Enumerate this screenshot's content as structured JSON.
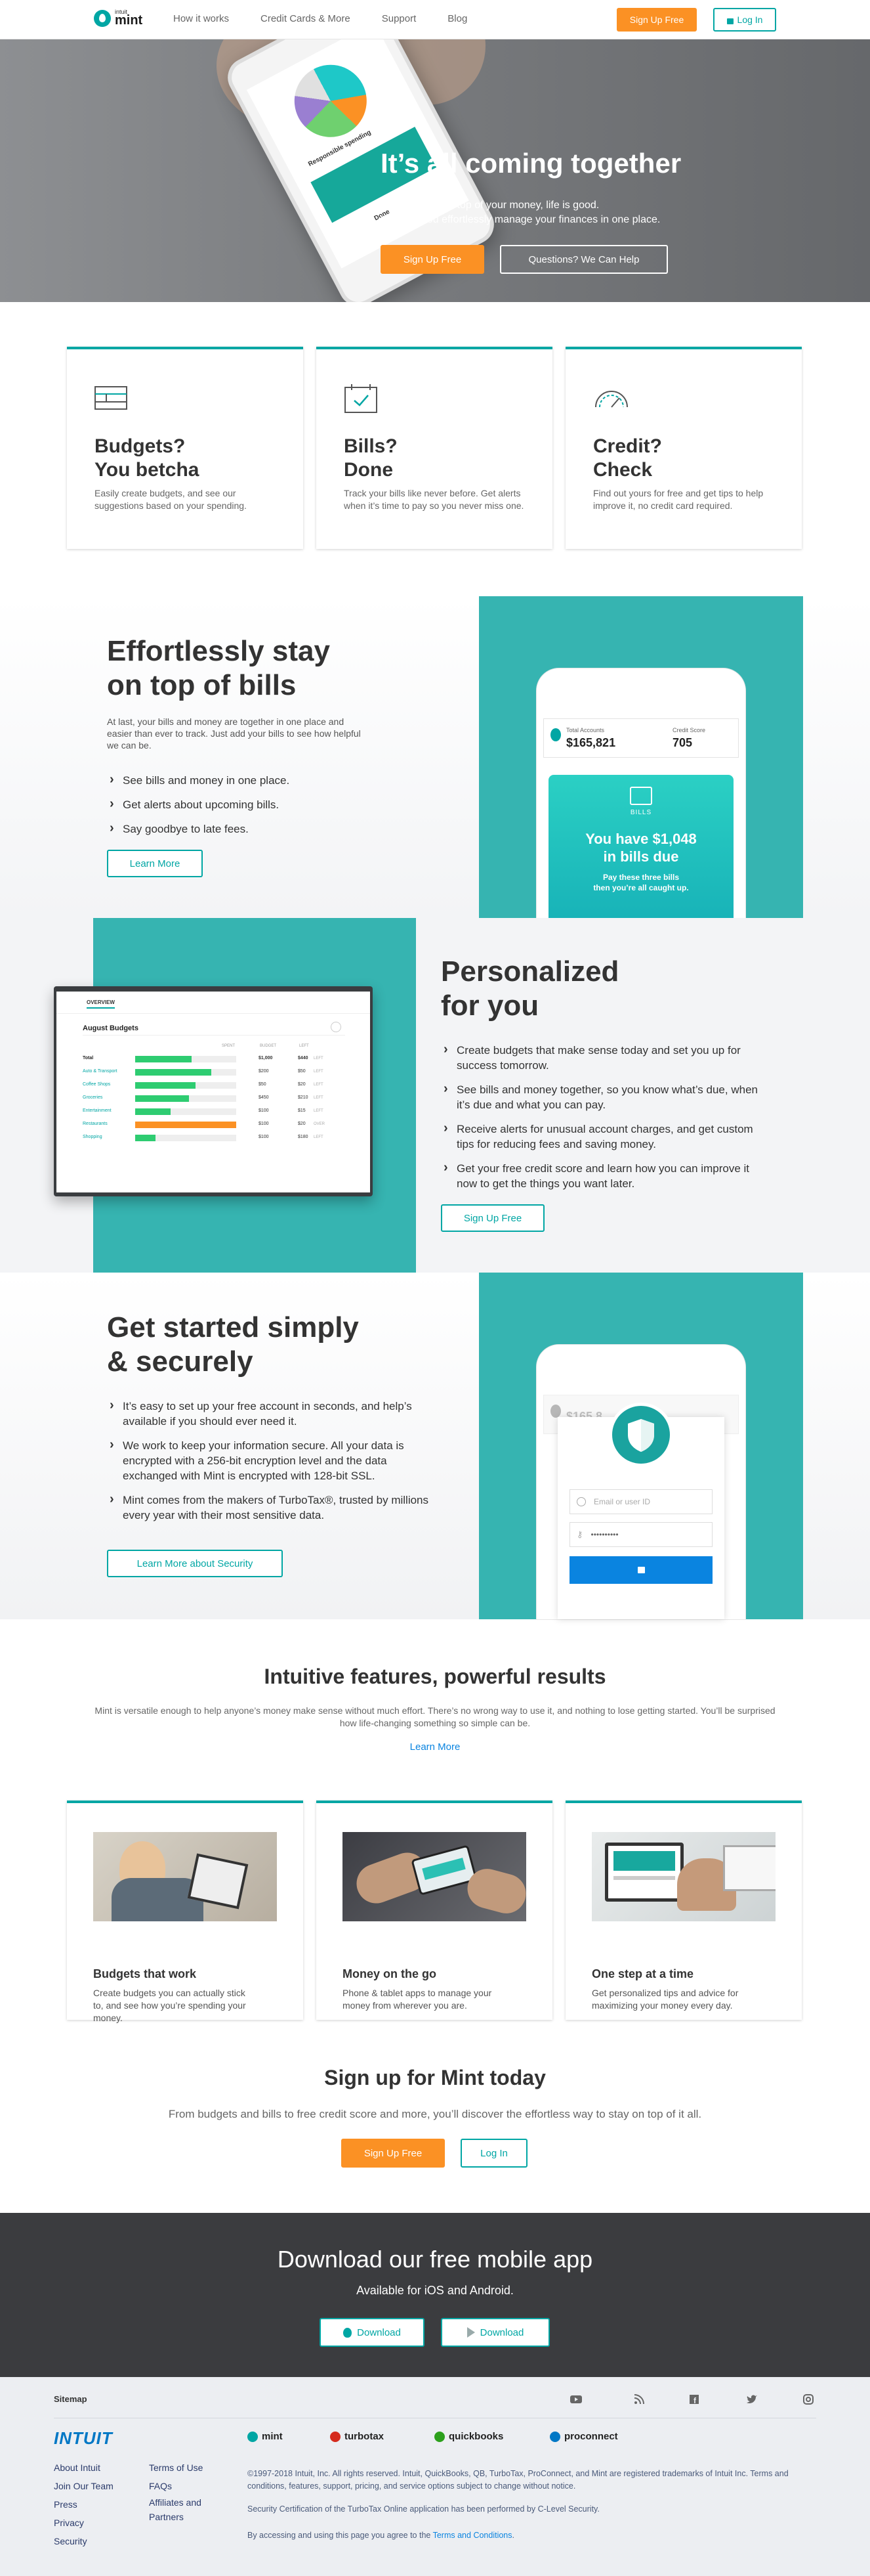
{
  "nav": {
    "logo_small": "intuit",
    "logo_big": "mint",
    "links": [
      "How it works",
      "Credit Cards & More",
      "Support",
      "Blog"
    ],
    "signup": "Sign Up Free",
    "login": "Log In"
  },
  "hero": {
    "title": "It’s all coming together",
    "line1": "When you’re on top of your money, life is good.",
    "line2": "We help you effortlessly manage your finances in one place.",
    "signup": "Sign Up Free",
    "questions": "Questions? We Can Help",
    "phone_text1": "Responsible spending",
    "phone_text2": "Done"
  },
  "cards": [
    {
      "title1": "Budgets?",
      "title2": "You betcha",
      "text": "Easily create budgets, and see our suggestions based on your spending."
    },
    {
      "title1": "Bills?",
      "title2": "Done",
      "text": "Track your bills like never before. Get alerts when it’s time to pay so you never miss one."
    },
    {
      "title1": "Credit?",
      "title2": "Check",
      "text": "Find out yours for free and get tips to help improve it, no credit card required."
    }
  ],
  "bills": {
    "title1": "Effortlessly stay",
    "title2": "on top of bills",
    "text": "At last, your bills and money are together in one place and easier than ever to track. Just add your bills to see how helpful we can be.",
    "bullets": [
      "See bills and money in one place.",
      "Get alerts about upcoming bills.",
      "Say goodbye to late fees."
    ],
    "button": "Learn More",
    "phone": {
      "accounts_label": "Total Accounts",
      "accounts_value": "$165,821",
      "score_label": "Credit Score",
      "score_value": "705",
      "card_label": "BILLS",
      "card_title1": "You have $1,048",
      "card_title2": "in bills due",
      "card_sub1": "Pay these three bills",
      "card_sub2": "then you’re all caught up."
    }
  },
  "personal": {
    "title1": "Personalized",
    "title2": "for you",
    "bullets": [
      "Create budgets that make sense today and set you up for success tomorrow.",
      "See bills and money together, so you know what’s due, when it’s due and what you can pay.",
      "Receive alerts for unusual account charges, and get custom tips for reducing fees and saving money.",
      "Get your free credit score and learn how you can improve it now to get the things you want later."
    ],
    "button": "Sign Up Free",
    "screen": {
      "tab": "OVERVIEW",
      "heading": "August Budgets",
      "col_spent": "SPENT",
      "col_budget": "BUDGET",
      "col_left": "LEFT",
      "rows": [
        {
          "name": "Total",
          "budget": "$1,000",
          "left": "$440",
          "left_unit": "LEFT",
          "fill": 0.56,
          "color": "#2ecc71",
          "bold": true
        },
        {
          "name": "Auto & Transport",
          "budget": "$200",
          "left": "$50",
          "left_unit": "LEFT",
          "fill": 0.75,
          "color": "#2ecc71",
          "bold": false
        },
        {
          "name": "Coffee Shops",
          "budget": "$50",
          "left": "$20",
          "left_unit": "LEFT",
          "fill": 0.6,
          "color": "#2ecc71",
          "bold": false
        },
        {
          "name": "Groceries",
          "budget": "$450",
          "left": "$210",
          "left_unit": "LEFT",
          "fill": 0.53,
          "color": "#2ecc71",
          "bold": false
        },
        {
          "name": "Entertainment",
          "budget": "$100",
          "left": "$15",
          "left_unit": "LEFT",
          "fill": 0.35,
          "color": "#2ecc71",
          "bold": false
        },
        {
          "name": "Restaurants",
          "budget": "$100",
          "left": "$20",
          "left_unit": "OVER",
          "fill": 1.0,
          "color": "#fb9124",
          "bold": false
        },
        {
          "name": "Shopping",
          "budget": "$100",
          "left": "$180",
          "left_unit": "LEFT",
          "fill": 0.2,
          "color": "#2ecc71",
          "bold": false
        }
      ]
    }
  },
  "secure": {
    "title1": "Get started simply",
    "title2": "& securely",
    "bullets": [
      "It’s easy to set up your free account in seconds, and help’s available if you should ever need it.",
      "We work to keep your information secure. All your data is encrypted with a 256-bit encryption level and the data exchanged with Mint is encrypted with 128-bit SSL.",
      "Mint comes from the makers of TurboTax®, trusted by millions every year with their most sensitive data."
    ],
    "button": "Learn More about Security",
    "phone": {
      "accounts_value": "$165,8",
      "email_placeholder": "Email or user ID",
      "password_value": "••••••••••"
    }
  },
  "features": {
    "title": "Intuitive features, powerful results",
    "text": "Mint is versatile enough to help anyone’s money make sense without much effort. There’s no wrong way to use it, and nothing to lose getting started. You’ll be surprised how life-changing something so simple can be.",
    "link": "Learn More",
    "cards": [
      {
        "title": "Budgets that work",
        "text": "Create budgets you can actually stick to, and see how you’re spending your money."
      },
      {
        "title": "Money on the go",
        "text": "Phone & tablet apps to manage your money from wherever you are."
      },
      {
        "title": "One step at a time",
        "text": "Get personalized tips and advice for maximizing your money every day."
      }
    ]
  },
  "signup": {
    "title": "Sign up for Mint today",
    "text": "From budgets and bills to free credit score and more, you’ll discover the effortless way to stay on top of it all.",
    "signup": "Sign Up Free",
    "login": "Log In"
  },
  "download": {
    "title": "Download our free mobile app",
    "sub": "Available for iOS and Android.",
    "ios": "Download",
    "android": "Download"
  },
  "footer": {
    "sitemap": "Sitemap",
    "intuit": "INTUIT",
    "col1": [
      "About Intuit",
      "Join Our Team",
      "Press",
      "Privacy",
      "Security"
    ],
    "col2": [
      "Terms of Use",
      "FAQs",
      "Affiliates and",
      "Partners"
    ],
    "brands": [
      "mint",
      "turbotax",
      "quickbooks",
      "proconnect"
    ],
    "brand_colors": [
      "#00a6a4",
      "#d52b1e",
      "#2ca01c",
      "#0077c5"
    ],
    "legal1": "©1997-2018 Intuit, Inc. All rights reserved. Intuit, QuickBooks, QB, TurboTax, ProConnect, and Mint are registered trademarks of Intuit Inc. Terms and conditions, features, support, pricing, and service options subject to change without notice.",
    "legal2": "Security Certification of the TurboTax Online application has been performed by C-Level Security.",
    "legal3_prefix": "By accessing and using this page you agree to the",
    "legal3_link": "Terms and Conditions",
    "legal3_suffix": "."
  }
}
